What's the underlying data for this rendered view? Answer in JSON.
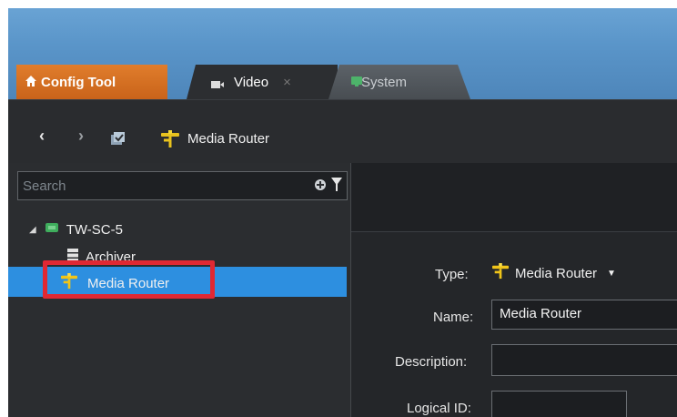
{
  "tabs": [
    {
      "label": "Config Tool",
      "icon": "home-icon"
    },
    {
      "label": "Video",
      "icon": "video-icon",
      "close": "×"
    },
    {
      "label": "System",
      "icon": "monitor-icon"
    }
  ],
  "nav": {
    "back": "‹",
    "forward": "›",
    "title": "Media Router",
    "title_icon": "media-router-icon"
  },
  "search": {
    "placeholder": "Search"
  },
  "tree": [
    {
      "label": "TW-SC-5",
      "icon": "server-icon",
      "expand": "◢"
    },
    {
      "label": "Archiver",
      "icon": "archiver-icon"
    },
    {
      "label": "Media Router",
      "icon": "media-router-icon",
      "selected": true
    }
  ],
  "properties": {
    "type_label": "Type:",
    "type_value": "Media Router",
    "type_arrow": "▼",
    "name_label": "Name:",
    "name_value": "Media Router",
    "description_label": "Description:",
    "description_value": "",
    "logical_id_label": "Logical ID:",
    "logical_id_value": ""
  },
  "colors": {
    "accent": "#2d8fe0",
    "highlight": "#e02833",
    "config_tab": "#e07d2c"
  }
}
